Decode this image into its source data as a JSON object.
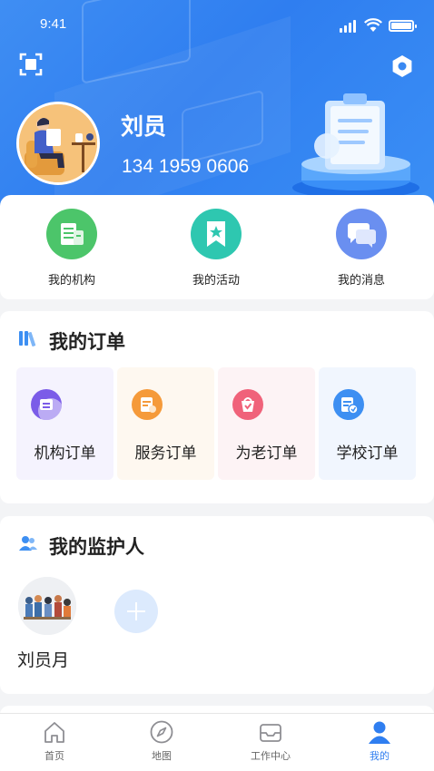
{
  "status": {
    "time": "9:41"
  },
  "user": {
    "name": "刘员",
    "phone": "134 1959 0606"
  },
  "quick_actions": [
    {
      "label": "我的机构",
      "icon": "building-doc-icon",
      "color": "#4cc56a"
    },
    {
      "label": "我的活动",
      "icon": "star-bookmark-icon",
      "color": "#2ec7b0"
    },
    {
      "label": "我的消息",
      "icon": "chat-bubbles-icon",
      "color": "#6a8ff0"
    }
  ],
  "orders": {
    "title": "我的订单",
    "items": [
      {
        "label": "机构订单",
        "icon": "institution-order-icon",
        "color": "#7b5ce8",
        "bg": "#f5f3fe"
      },
      {
        "label": "服务订单",
        "icon": "service-order-icon",
        "color": "#f59a3a",
        "bg": "#fef8f0"
      },
      {
        "label": "为老订单",
        "icon": "elderly-order-icon",
        "color": "#f0627a",
        "bg": "#fdf3f5"
      },
      {
        "label": "学校订单",
        "icon": "school-order-icon",
        "color": "#3d8ff2",
        "bg": "#f1f6fe"
      }
    ]
  },
  "guardians": {
    "title": "我的监护人",
    "people": [
      {
        "name": "刘员月"
      }
    ]
  },
  "tabs": [
    {
      "label": "首页",
      "icon": "home-icon"
    },
    {
      "label": "地图",
      "icon": "compass-icon"
    },
    {
      "label": "工作中心",
      "icon": "inbox-icon"
    },
    {
      "label": "我的",
      "icon": "person-icon",
      "active": true
    }
  ],
  "colors": {
    "brand": "#2f7ef0",
    "header": "#3f8ef3"
  }
}
